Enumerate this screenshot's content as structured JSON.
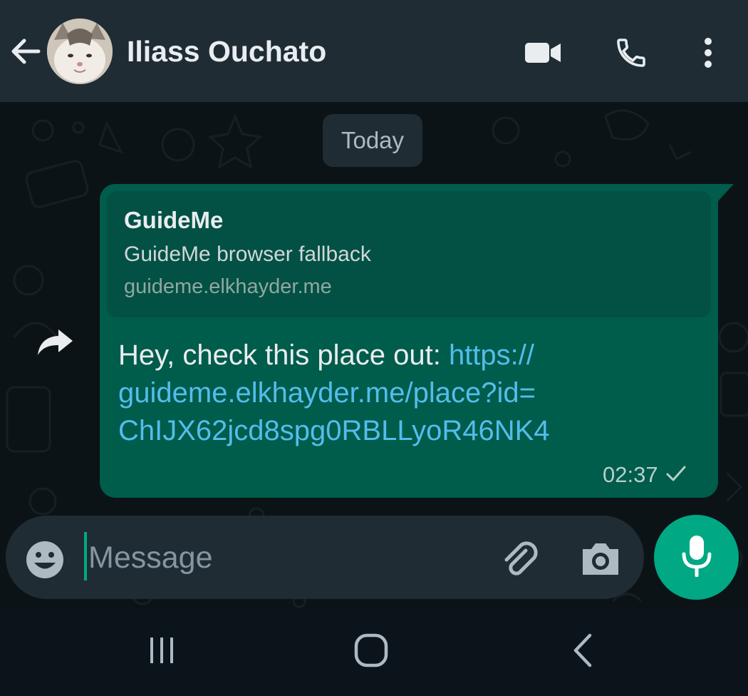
{
  "header": {
    "contact_name": "Iliass Ouchato"
  },
  "chat": {
    "date_label": "Today",
    "message": {
      "preview": {
        "title": "GuideMe",
        "description": "GuideMe browser fallback",
        "domain": "guideme.elkhayder.me"
      },
      "text_prefix": "Hey, check this place out: ",
      "link_line1": "https://",
      "link_line2": "guideme.elkhayder.me/place?id=",
      "link_line3": "ChIJX62jcd8spg0RBLLyoR46NK4",
      "time": "02:37",
      "status_icon": "single-check-icon"
    }
  },
  "composer": {
    "placeholder": "Message"
  },
  "colors": {
    "header_bg": "#1f2c34",
    "bubble_out": "#005c4b",
    "link": "#53bdeb",
    "accent": "#00a884"
  }
}
